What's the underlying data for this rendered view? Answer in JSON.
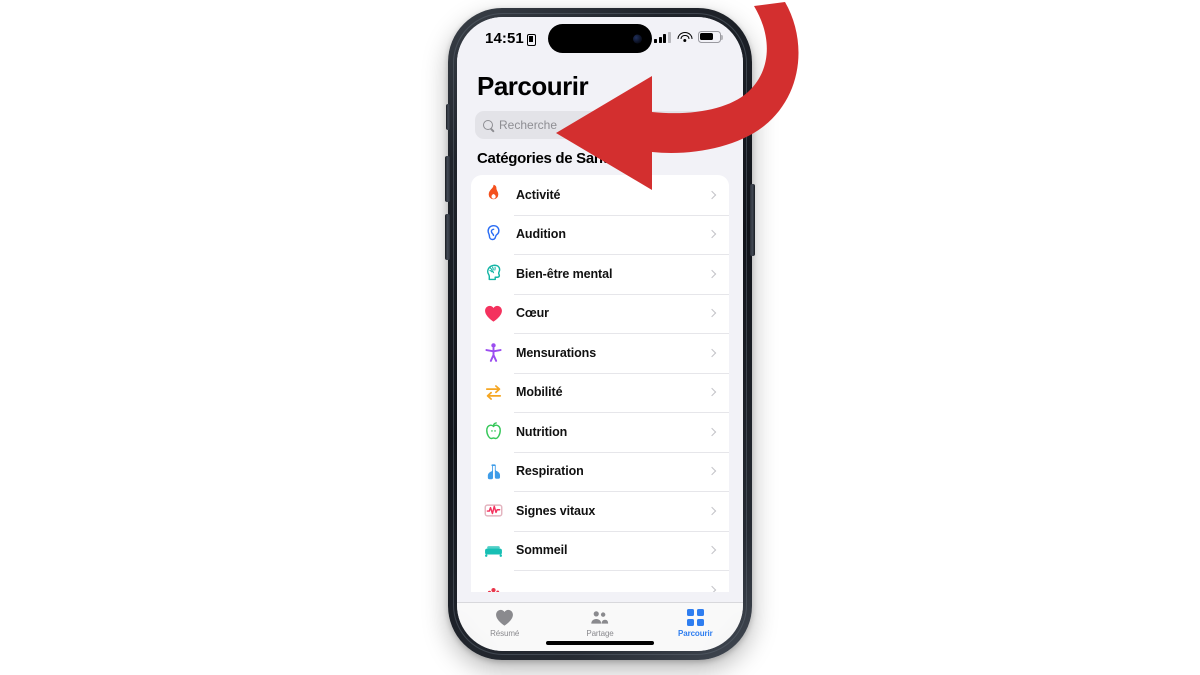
{
  "status_bar": {
    "time": "14:51",
    "time_badge_icon": "alarm-badge-icon",
    "cellular_icon": "cellular-signal-icon",
    "wifi_icon": "wifi-icon",
    "battery_icon": "battery-icon"
  },
  "header": {
    "title": "Parcourir",
    "search": {
      "placeholder": "Recherche",
      "value": "",
      "search_icon": "search-icon",
      "mic_icon": "microphone-icon"
    },
    "section_title": "Catégories de Santé"
  },
  "categories": [
    {
      "label": "Activité",
      "icon": "flame-icon",
      "color": "#f4511e"
    },
    {
      "label": "Audition",
      "icon": "ear-icon",
      "color": "#2a6df4"
    },
    {
      "label": "Bien-être mental",
      "icon": "head-brain-icon",
      "color": "#12b5a5"
    },
    {
      "label": "Cœur",
      "icon": "heart-icon",
      "color": "#f4325e"
    },
    {
      "label": "Mensurations",
      "icon": "body-icon",
      "color": "#9b4df0"
    },
    {
      "label": "Mobilité",
      "icon": "arrows-icon",
      "color": "#f5a623"
    },
    {
      "label": "Nutrition",
      "icon": "apple-icon",
      "color": "#35c759"
    },
    {
      "label": "Respiration",
      "icon": "lungs-icon",
      "color": "#3e9ce8"
    },
    {
      "label": "Signes vitaux",
      "icon": "waveform-icon",
      "color": "#f4325e"
    },
    {
      "label": "Sommeil",
      "icon": "bed-icon",
      "color": "#17bfb4"
    },
    {
      "label": "",
      "icon": "symptoms-icon",
      "color": "#e8344a"
    }
  ],
  "chevron_icon": "chevron-right-icon",
  "tabs": [
    {
      "label": "Résumé",
      "icon": "heart-icon",
      "active": false
    },
    {
      "label": "Partage",
      "icon": "people-icon",
      "active": false
    },
    {
      "label": "Parcourir",
      "icon": "grid-icon",
      "active": true
    }
  ],
  "annotation": {
    "arrow_icon": "curved-red-arrow-icon",
    "color": "#d32f2f"
  },
  "colors": {
    "accent": "#2f7ef0",
    "page_background": "#ffffff",
    "screen_background": "#f2f2f7",
    "card_background": "#ffffff"
  }
}
